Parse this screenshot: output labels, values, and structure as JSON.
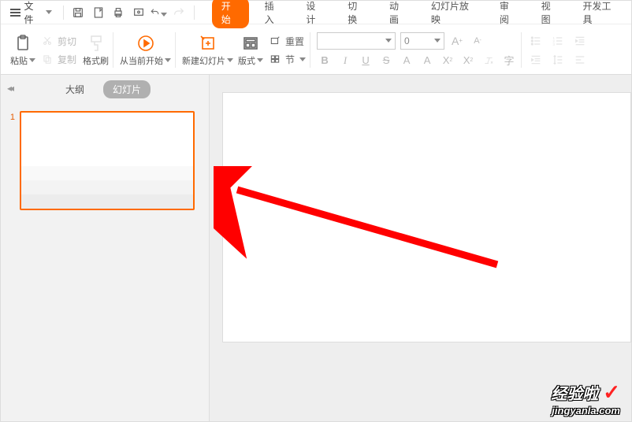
{
  "topbar": {
    "file_label": "文件",
    "tabs": {
      "start": "开始",
      "insert": "插入",
      "design": "设计",
      "transition": "切换",
      "animation": "动画",
      "slideshow": "幻灯片放映",
      "review": "审阅",
      "view": "视图",
      "devtools": "开发工具"
    }
  },
  "ribbon": {
    "paste_label": "粘贴",
    "cut_label": "剪切",
    "copy_label": "复制",
    "format_painter_label": "格式刷",
    "from_current_label": "从当前开始",
    "new_slide_label": "新建幻灯片",
    "layout_label": "版式",
    "reset_label": "重置",
    "section_label": "节",
    "font_value": "",
    "font_size_value": "0"
  },
  "sidepanel": {
    "outline_label": "大纲",
    "slides_label": "幻灯片",
    "slide_number": "1"
  },
  "watermark": {
    "line1": "经验啦",
    "line2": "jingyanla.com"
  }
}
